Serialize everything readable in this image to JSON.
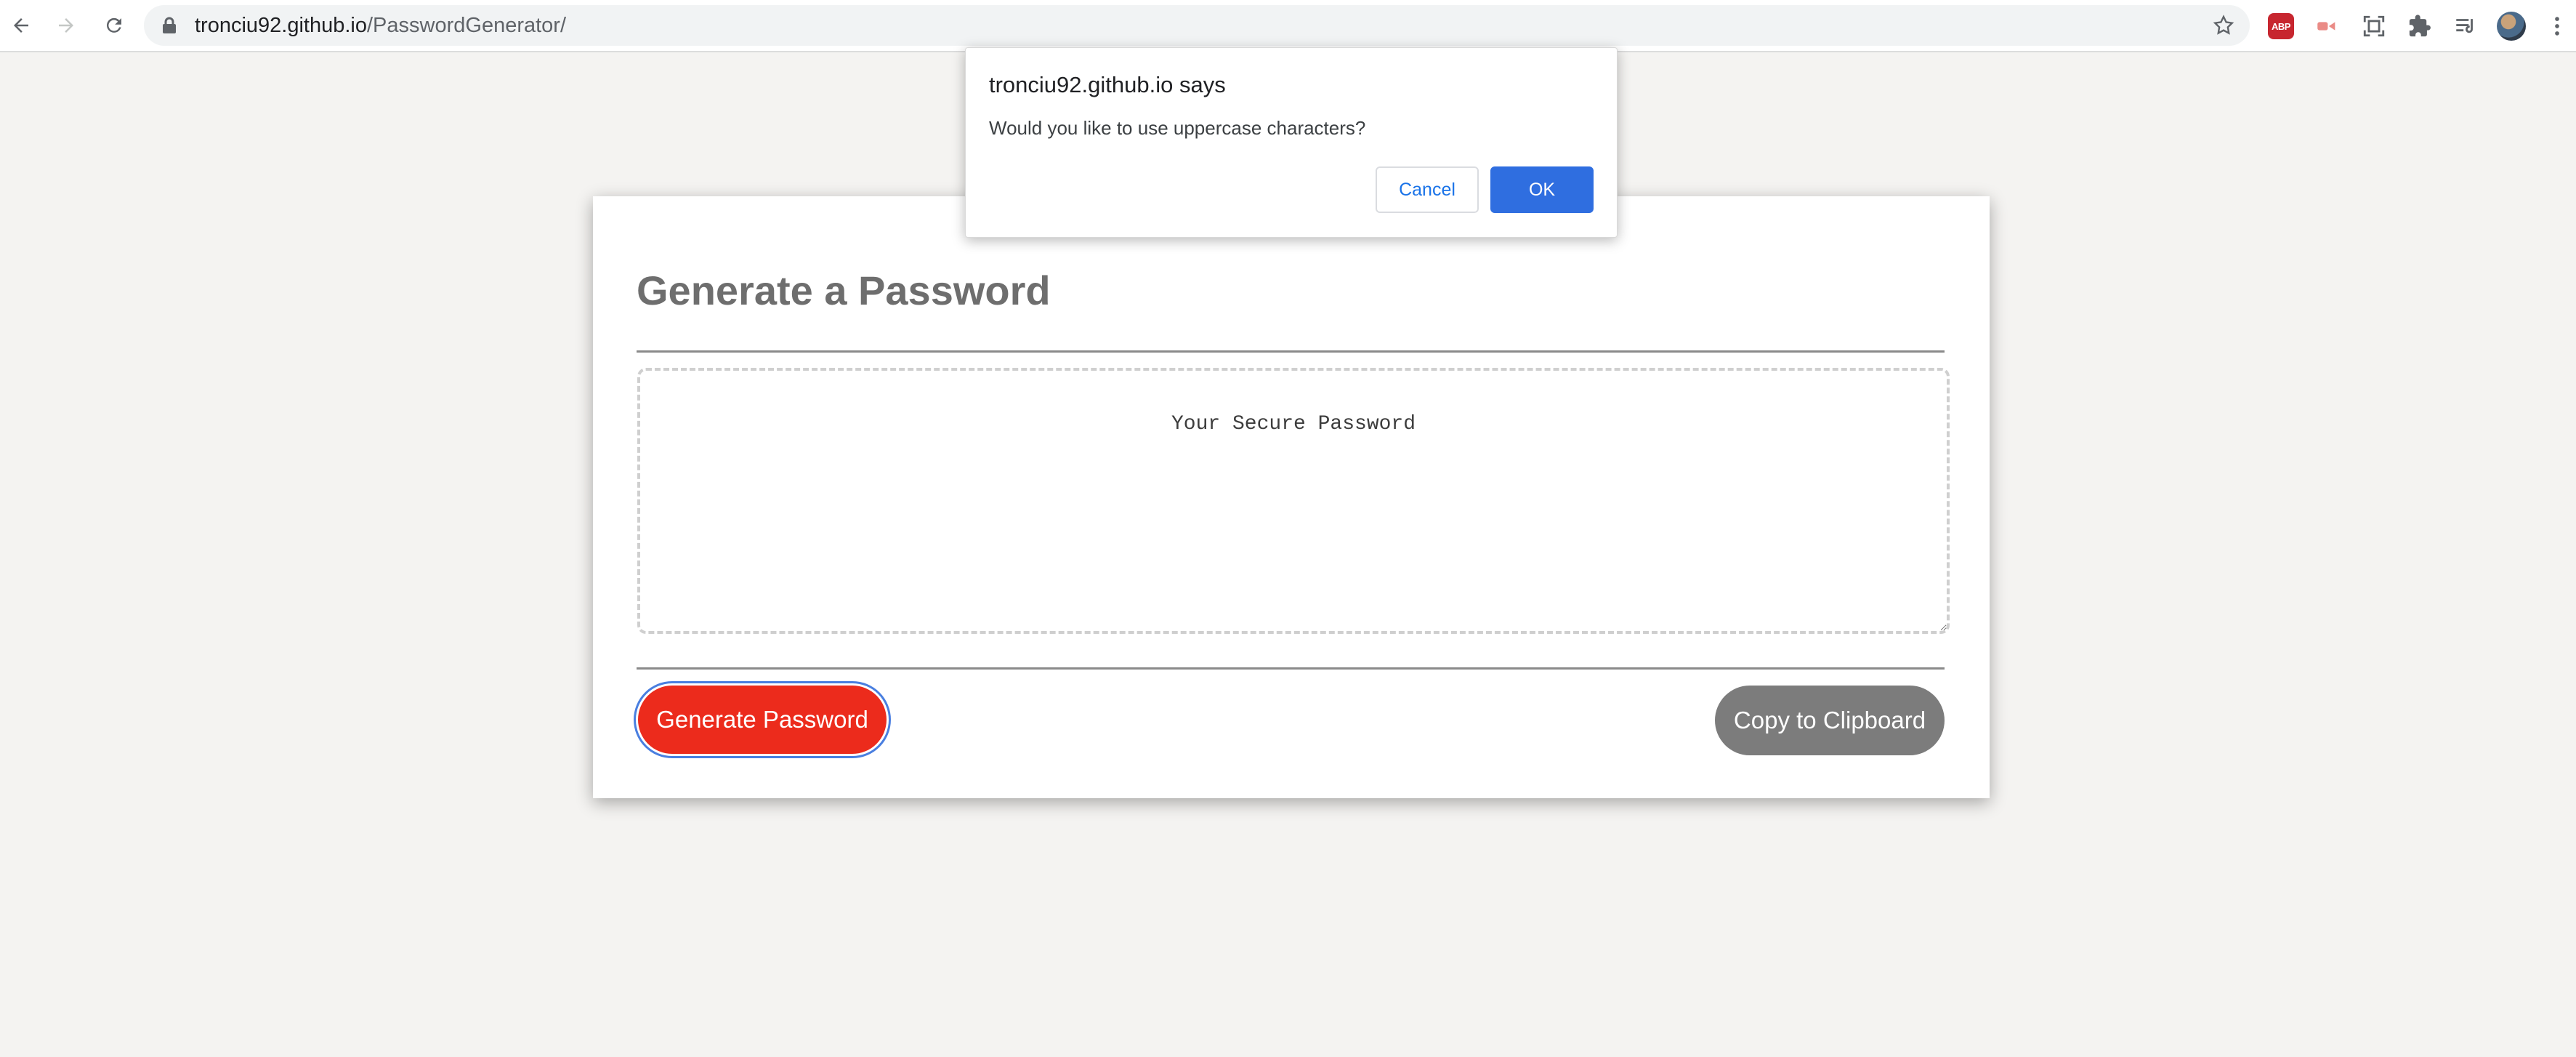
{
  "browser": {
    "url_host": "tronciu92.github.io",
    "url_path": "/PasswordGenerator/",
    "icons": [
      "back-icon",
      "forward-icon",
      "reload-icon",
      "lock-icon",
      "star-icon",
      "adblock-icon",
      "cast-icon",
      "screenshot-icon",
      "extensions-icon",
      "reading-list-icon",
      "profile-avatar",
      "menu-icon"
    ],
    "adblock_label": "ABP"
  },
  "card": {
    "title": "Generate a Password",
    "password_placeholder": "Your Secure Password",
    "generate_label": "Generate Password",
    "copy_label": "Copy to Clipboard"
  },
  "dialog": {
    "title": "tronciu92.github.io says",
    "message": "Would you like to use uppercase characters?",
    "cancel_label": "Cancel",
    "ok_label": "OK"
  },
  "colors": {
    "page_background": "#f4f3f1",
    "generate_button": "#ec2b1c",
    "copy_button": "#7c7c7c",
    "dialog_ok": "#2f6ee0"
  }
}
